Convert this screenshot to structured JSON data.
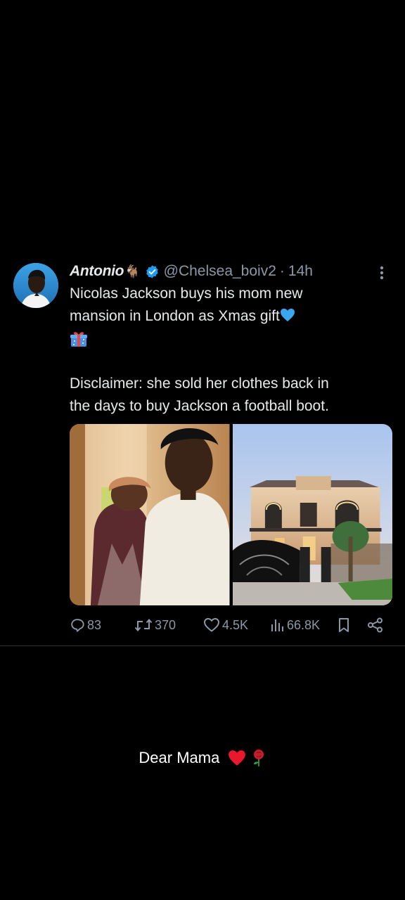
{
  "tweet": {
    "display_name": "Antonio",
    "handle": "@Chelsea_boiv2",
    "separator": "·",
    "time": "14h",
    "line1": "Nicolas Jackson buys his mom new",
    "line2": "mansion in London as Xmas gift",
    "disclaimer_line1": "Disclaimer: she sold her clothes back in",
    "disclaimer_line2": "the days to buy Jackson a football boot.",
    "icons": {
      "name_emoji": "goat-icon",
      "verified": "verified-icon",
      "more": "more-icon",
      "heart": "blue-heart-icon",
      "gift": "gift-icon"
    },
    "media": [
      {
        "name": "photo-jackson-and-mother"
      },
      {
        "name": "photo-mansion"
      }
    ],
    "actions": {
      "replies": "83",
      "reposts": "370",
      "likes": "4.5K",
      "views": "66.8K"
    }
  },
  "caption": {
    "text": "Dear Mama",
    "icons": [
      "red-heart-icon",
      "rose-icon"
    ]
  },
  "colors": {
    "background": "#000000",
    "text": "#e7e9ea",
    "muted": "#8b98a5",
    "accent": "#1d9bf0"
  }
}
